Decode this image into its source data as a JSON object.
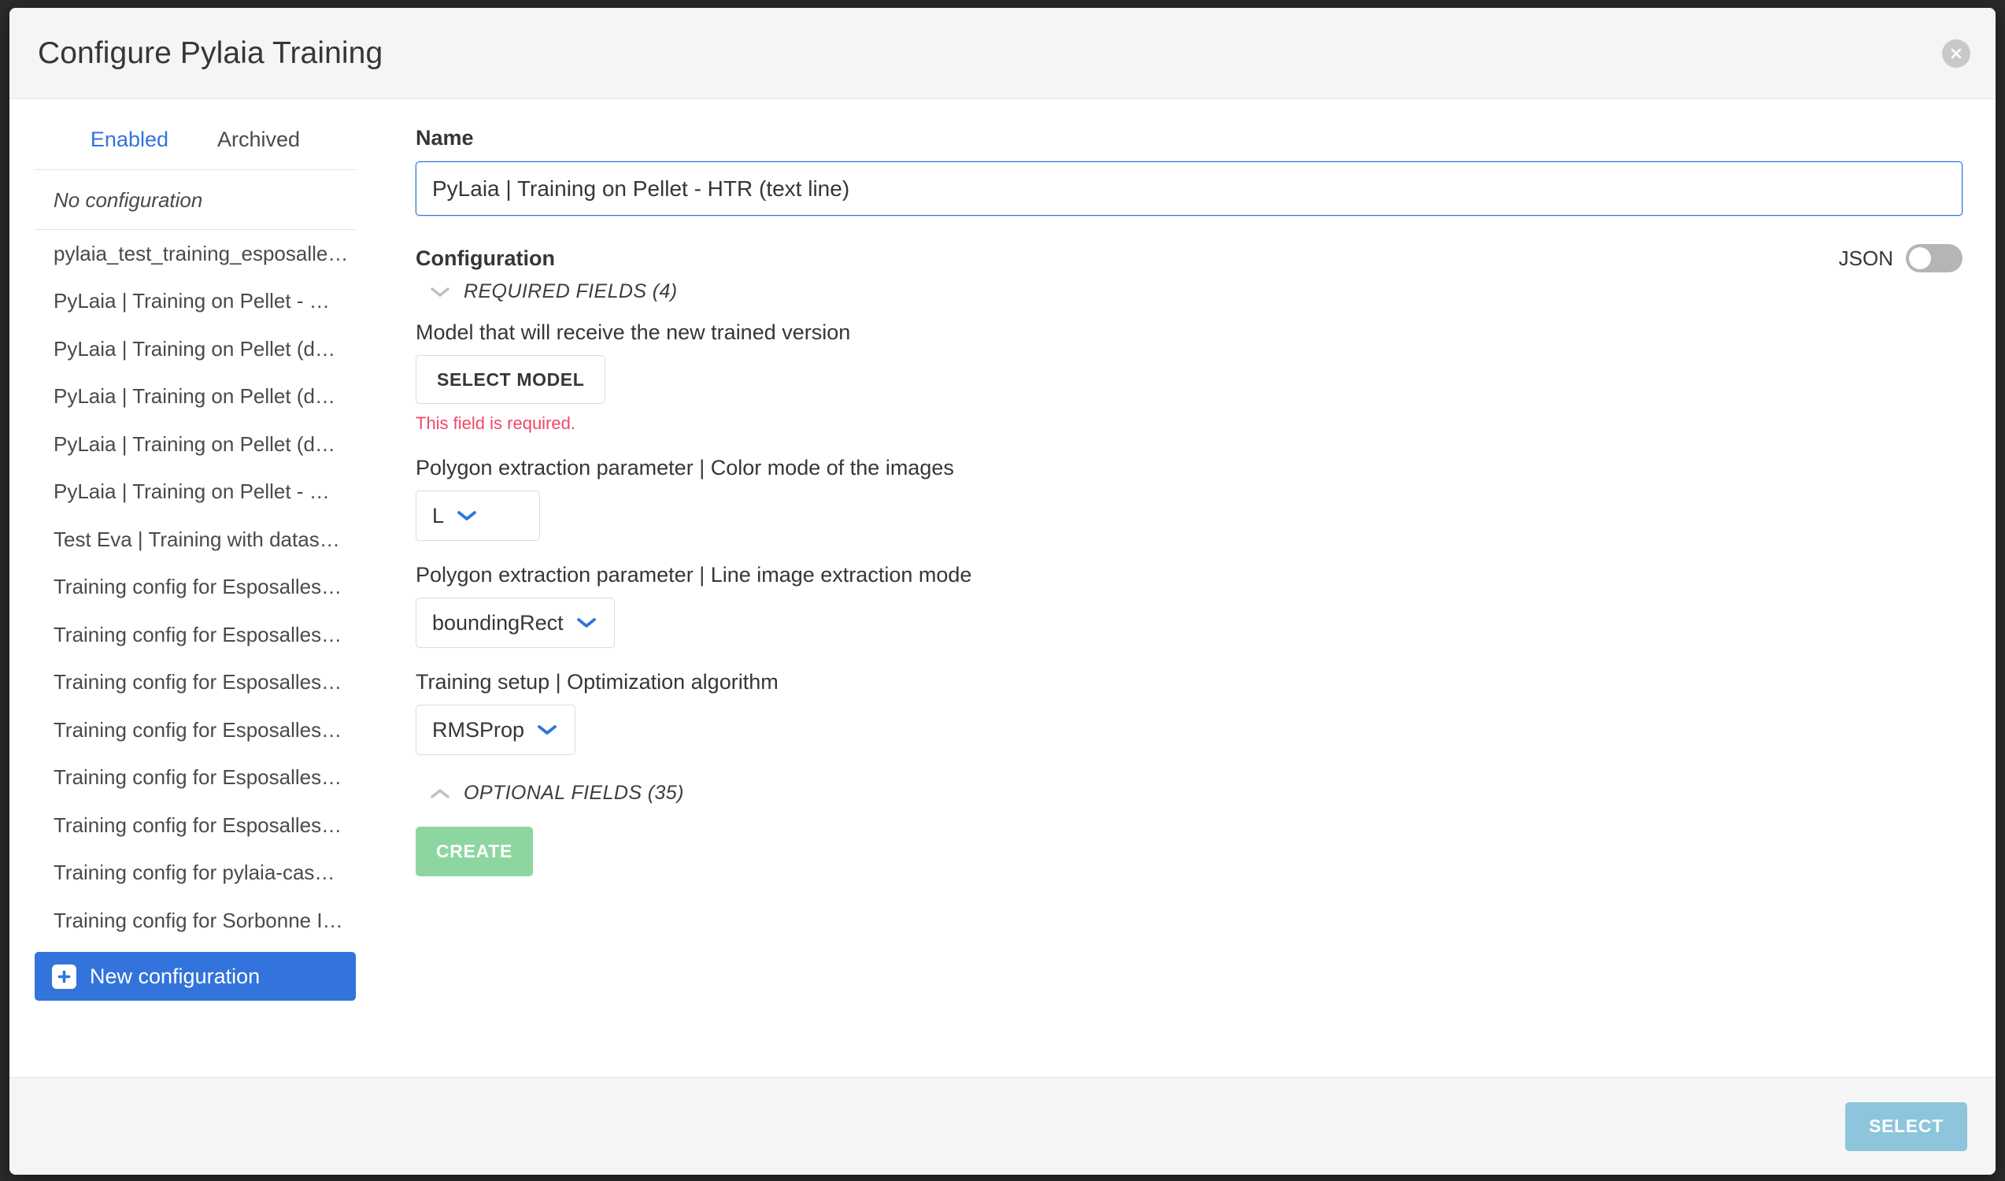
{
  "modal": {
    "title": "Configure Pylaia Training",
    "close_icon": "close-icon"
  },
  "sidebar": {
    "tabs": [
      {
        "label": "Enabled",
        "active": true
      },
      {
        "label": "Archived",
        "active": false
      }
    ],
    "empty_label": "No configuration",
    "items": [
      {
        "label": "pylaia_test_training_esposalle…"
      },
      {
        "label": "PyLaia | Training on Pellet - …"
      },
      {
        "label": "PyLaia | Training on Pellet (d…"
      },
      {
        "label": "PyLaia | Training on Pellet (d…"
      },
      {
        "label": "PyLaia | Training on Pellet (d…"
      },
      {
        "label": "PyLaia | Training on Pellet - …"
      },
      {
        "label": "Test Eva | Training with datas…"
      },
      {
        "label": "Training config for Esposalles…"
      },
      {
        "label": "Training config for Esposalles…"
      },
      {
        "label": "Training config for Esposalles…"
      },
      {
        "label": "Training config for Esposalles…"
      },
      {
        "label": "Training config for Esposalles…"
      },
      {
        "label": "Training config for Esposalles…"
      },
      {
        "label": "Training config for pylaia-cas…"
      },
      {
        "label": "Training config for Sorbonne I…"
      }
    ],
    "new_config_label": "New configuration",
    "new_config_icon": "plus-square-icon"
  },
  "form": {
    "name_label": "Name",
    "name_value": "PyLaia | Training on Pellet - HTR (text line)",
    "name_placeholder": "Name",
    "configuration_label": "Configuration",
    "json_label": "JSON",
    "json_enabled": false,
    "required_section": {
      "title": "REQUIRED FIELDS (4)",
      "expanded": true,
      "chevron_icon": "chevron-down-icon"
    },
    "optional_section": {
      "title": "OPTIONAL FIELDS (35)",
      "expanded": false,
      "chevron_icon": "chevron-up-icon"
    },
    "fields": {
      "model": {
        "question": "Model that will receive the new trained version",
        "button_label": "SELECT MODEL",
        "error": "This field is required."
      },
      "color_mode": {
        "question": "Polygon extraction parameter | Color mode of the images",
        "value": "L"
      },
      "extraction_mode": {
        "question": "Polygon extraction parameter | Line image extraction mode",
        "value": "boundingRect"
      },
      "optimizer": {
        "question": "Training setup | Optimization algorithm",
        "value": "RMSProp"
      }
    },
    "create_label": "CREATE"
  },
  "footer": {
    "select_label": "SELECT"
  },
  "colors": {
    "accent_blue": "#3273dc",
    "error_red": "#f14668",
    "create_green": "#8ed6a0",
    "select_blue": "#8dc5dd",
    "toggle_off": "#b5b5b5"
  }
}
